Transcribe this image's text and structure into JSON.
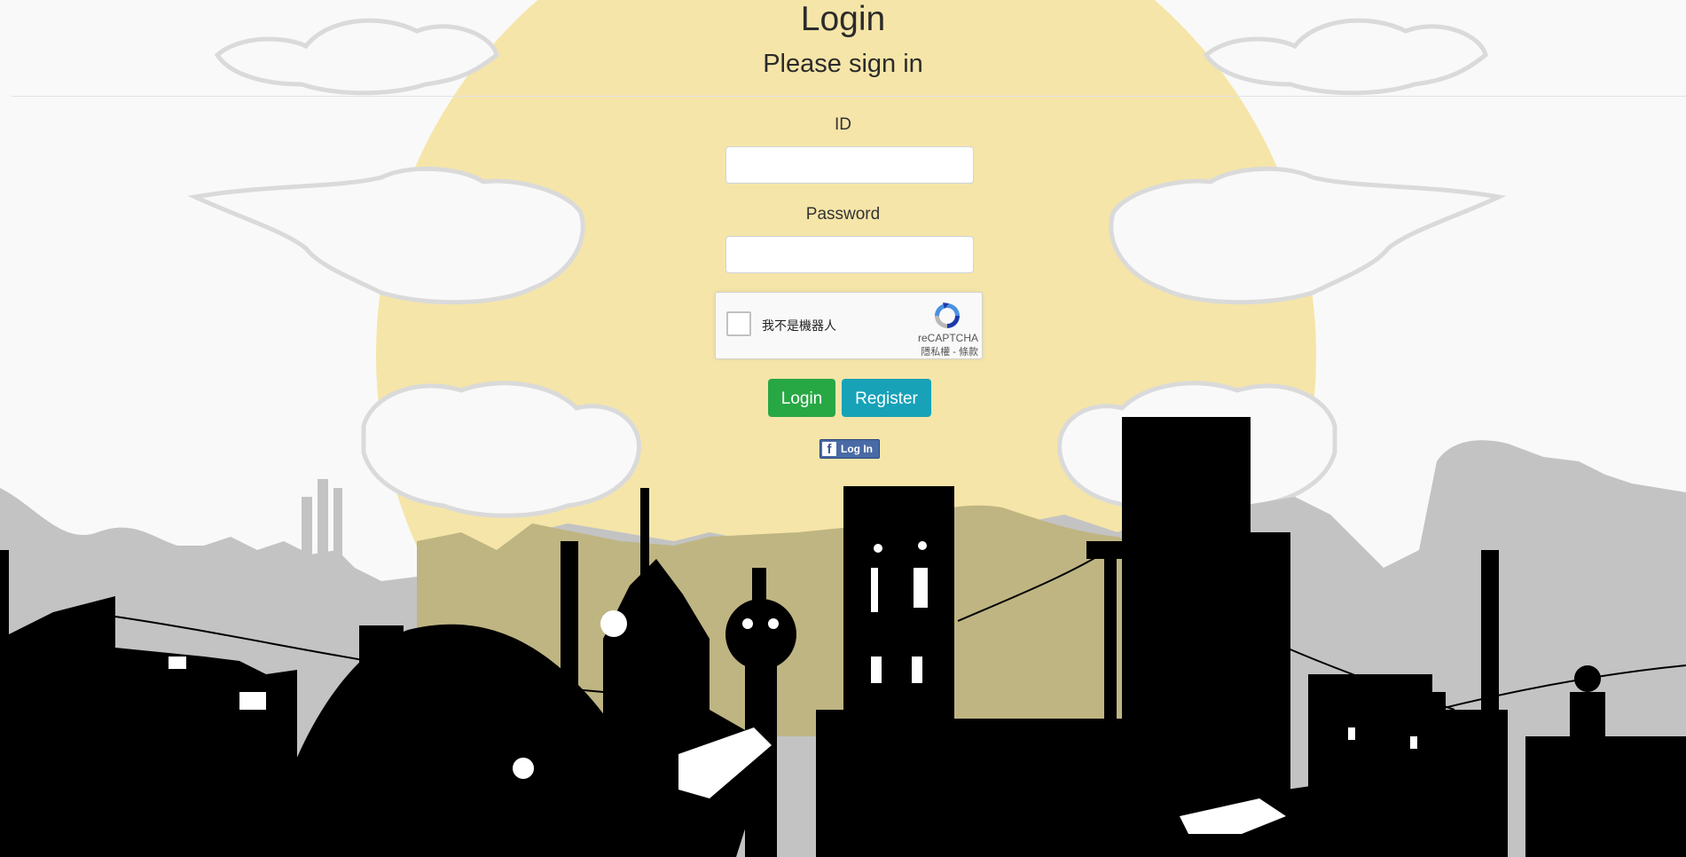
{
  "header": {
    "title": "Login",
    "subtitle": "Please sign in"
  },
  "form": {
    "id_label": "ID",
    "id_value": "",
    "password_label": "Password",
    "password_value": ""
  },
  "captcha": {
    "checkbox_text": "我不是機器人",
    "brand": "reCAPTCHA",
    "links": "隱私權 - 條款",
    "icon": "recaptcha-icon"
  },
  "buttons": {
    "login_label": "Login",
    "register_label": "Register",
    "facebook_label": "Log In",
    "facebook_icon": "facebook-icon"
  },
  "colors": {
    "login_button": "#28a745",
    "register_button": "#17a2b8",
    "facebook_button": "#4a6aa5",
    "sun": "#f5e5a8"
  }
}
